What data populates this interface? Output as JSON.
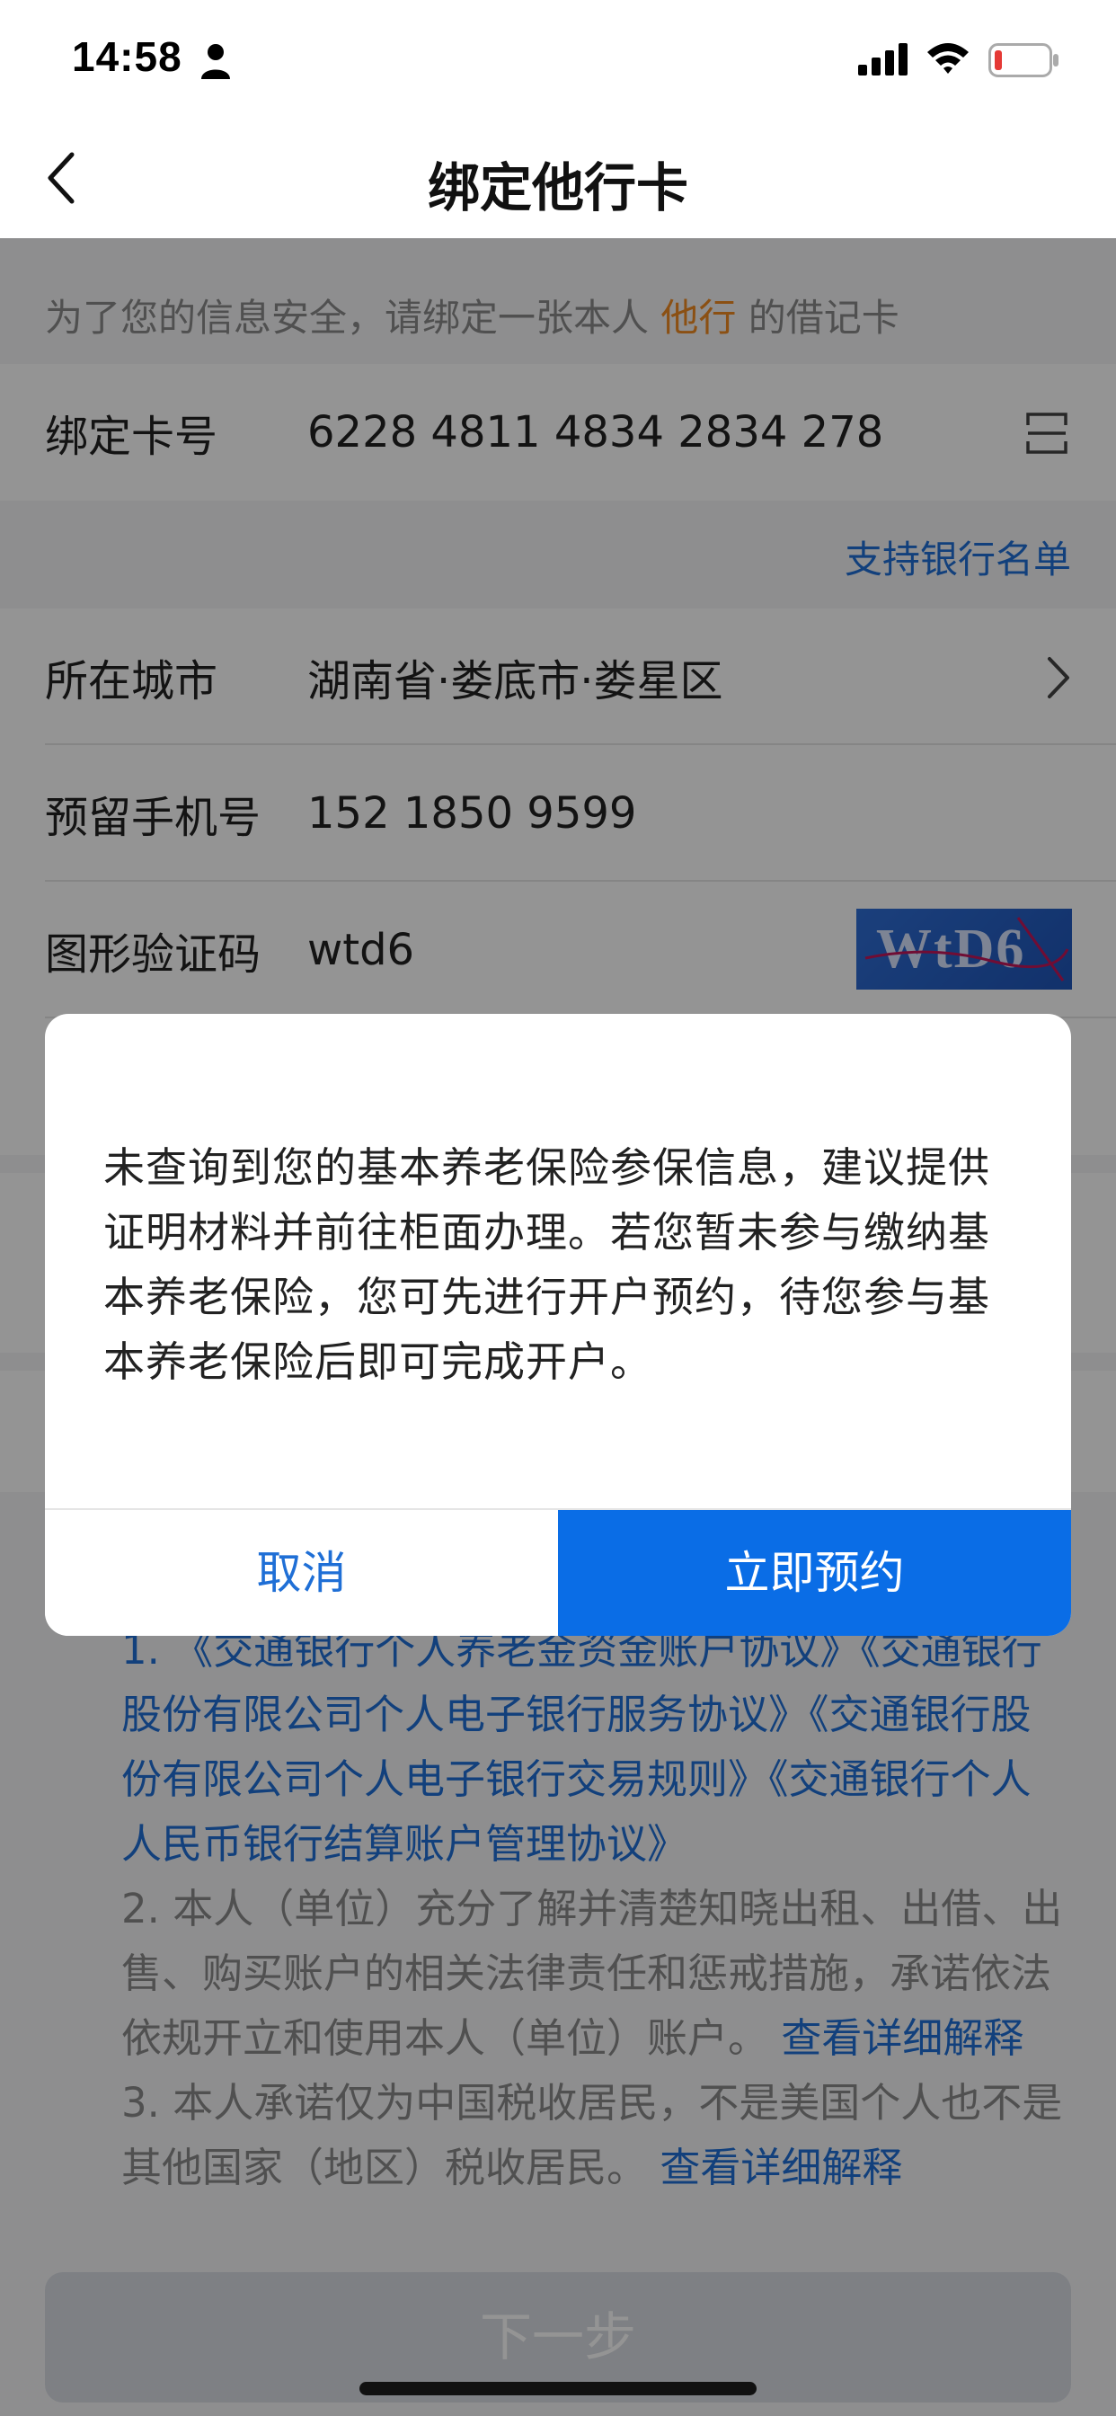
{
  "status_bar": {
    "time": "14:58",
    "icons": [
      "person-icon",
      "signal-icon",
      "wifi-icon",
      "battery-icon"
    ]
  },
  "nav": {
    "title": "绑定他行卡",
    "back_icon": "chevron-left-icon"
  },
  "notice": {
    "prefix": "为了您的信息安全，请绑定一张本人",
    "highlight": "他行",
    "suffix": "的借记卡",
    "highlight_color": "#f08a22"
  },
  "form": {
    "card": {
      "label": "绑定卡号",
      "value": "6228 4811 4834 2834 278",
      "icon": "scan-icon"
    },
    "support_link": "支持银行名单",
    "city": {
      "label": "所在城市",
      "value": "湖南省·娄底市·娄星区",
      "icon": "chevron-right-icon"
    },
    "phone": {
      "label": "预留手机号",
      "value": "152 1850 9599"
    },
    "captcha": {
      "label": "图形验证码",
      "value": "wtd6",
      "image_text": "WtD6"
    }
  },
  "agreements": {
    "item1_tail": "1. 《交通银行个人养老金资金账户协议》《交通银行",
    "item1_links": "股份有限公司个人电子银行服务协议》《交通银行股份有限公司个人电子银行交易规则》《交通银行个人人民币银行结算账户管理协议》",
    "item2": "2. 本人（单位）充分了解并清楚知晓出租、出借、出售、购买账户的相关法律责任和惩戒措施，承诺依法依规开立和使用本人（单位）账户。",
    "item2_link": "查看详细解释",
    "item3": "3. 本人承诺仅为中国税收居民，不是美国个人也不是其他国家（地区）税收居民。",
    "item3_link": "查看详细解释"
  },
  "next_button": "下一步",
  "dialog": {
    "message": "未查询到您的基本养老保险参保信息，建议提供证明材料并前往柜面办理。若您暂未参与缴纳基本养老保险，您可先进行开户预约，待您参与基本养老保险后即可完成开户。",
    "cancel_label": "取消",
    "confirm_label": "立即预约",
    "confirm_color": "#0a6de6",
    "link_color": "#1f6fd6"
  }
}
